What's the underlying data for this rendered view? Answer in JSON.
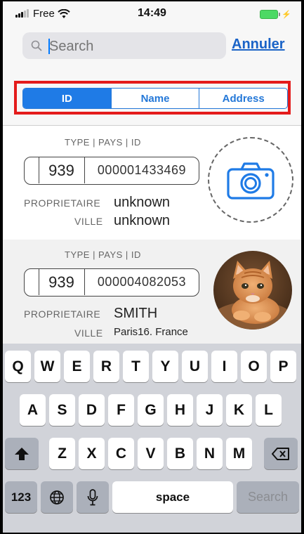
{
  "status_bar": {
    "carrier": "Free",
    "time": "14:49"
  },
  "search": {
    "placeholder": "Search",
    "cancel_label": "Annuler"
  },
  "segments": [
    {
      "label": "ID",
      "active": true
    },
    {
      "label": "Name",
      "active": false
    },
    {
      "label": "Address",
      "active": false
    }
  ],
  "records": [
    {
      "type_header": "TYPE | PAYS | ID",
      "pays": "939",
      "id": "000001433469",
      "owner_label": "PROPRIETAIRE",
      "owner": "unknown",
      "city_label": "VILLE",
      "city": "unknown",
      "photo": "camera-icon"
    },
    {
      "type_header": "TYPE | PAYS | ID",
      "pays": "939",
      "id": "000004082053",
      "owner_label": "PROPRIETAIRE",
      "owner": "SMITH",
      "city_label": "VILLE",
      "city": "Paris16. France",
      "photo": "cat-photo"
    }
  ],
  "keyboard": {
    "row1": [
      "Q",
      "W",
      "E",
      "R",
      "T",
      "Y",
      "U",
      "I",
      "O",
      "P"
    ],
    "row2": [
      "A",
      "S",
      "D",
      "F",
      "G",
      "H",
      "J",
      "K",
      "L"
    ],
    "row3": [
      "Z",
      "X",
      "C",
      "V",
      "B",
      "N",
      "M"
    ],
    "numbers_label": "123",
    "space_label": "space",
    "search_label": "Search"
  },
  "colors": {
    "accent": "#1f7be6",
    "highlight": "#e41b1b",
    "battery": "#4cd964"
  }
}
